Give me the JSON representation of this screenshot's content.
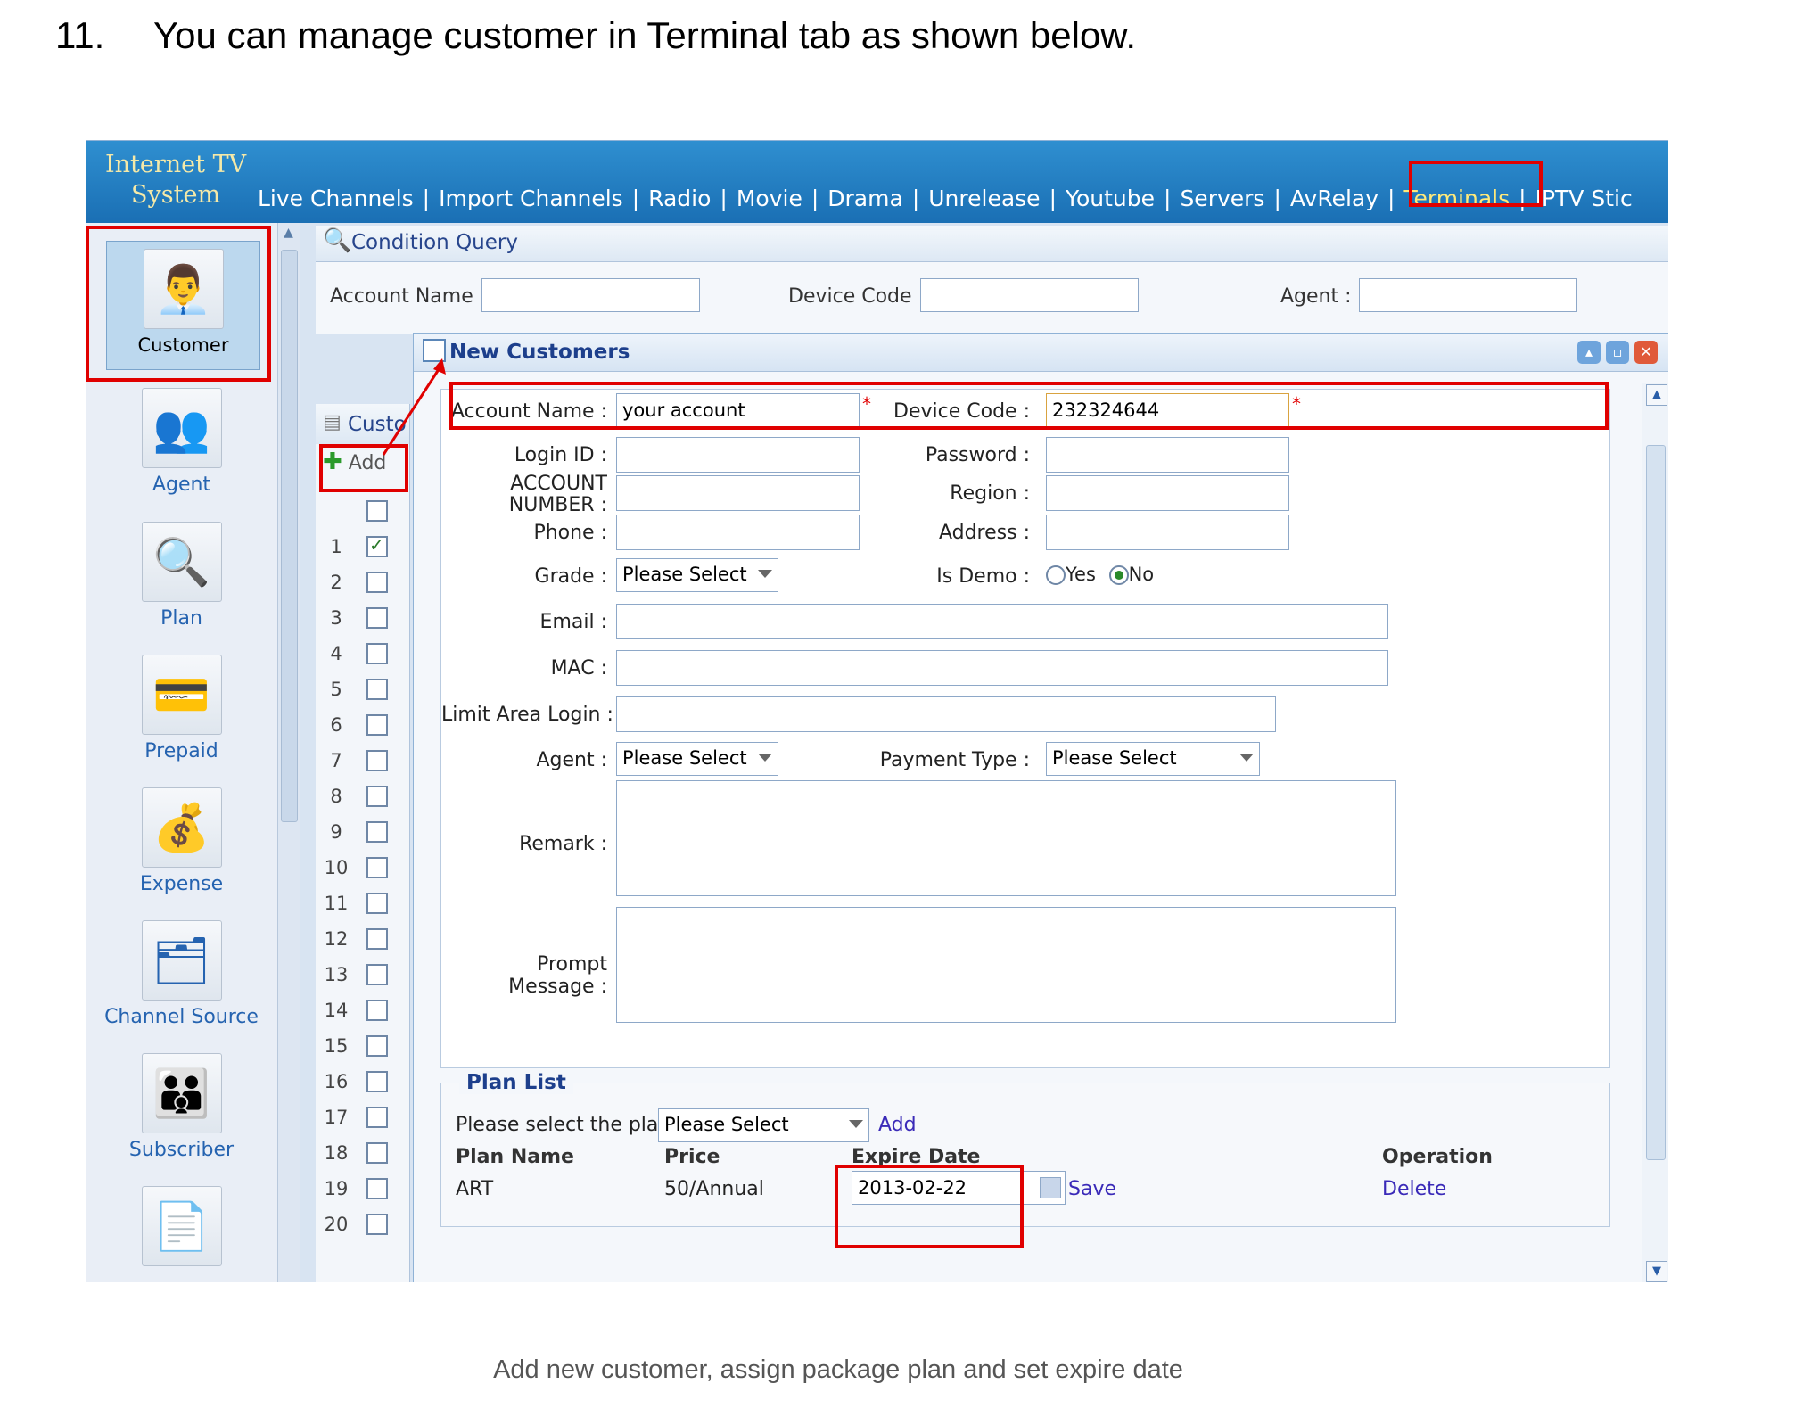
{
  "doc": {
    "step_number": "11.",
    "step_text": "You can manage customer in Terminal tab as shown below.",
    "caption": "Add new customer, assign package plan and set expire date"
  },
  "app": {
    "logo_line1": "Internet TV",
    "logo_line2": "System"
  },
  "nav": {
    "items": [
      "Live Channels",
      "Import Channels",
      "Radio",
      "Movie",
      "Drama",
      "Unrelease",
      "Youtube",
      "Servers",
      "AvRelay",
      "Terminals",
      "IPTV Stic"
    ],
    "active": "Terminals"
  },
  "sidebar": {
    "items": [
      {
        "label": "Customer",
        "icon": "customer-icon"
      },
      {
        "label": "Agent",
        "icon": "agent-icon"
      },
      {
        "label": "Plan",
        "icon": "plan-icon"
      },
      {
        "label": "Prepaid",
        "icon": "prepaid-card-icon"
      },
      {
        "label": "Expense",
        "icon": "expense-icon"
      },
      {
        "label": "Channel Source",
        "icon": "channel-source-icon"
      },
      {
        "label": "Subscriber",
        "icon": "subscriber-icon"
      },
      {
        "label": "",
        "icon": "document-icon"
      }
    ]
  },
  "condition_query": {
    "title": "Condition Query",
    "account_name_label": "Account Name :",
    "device_code_label": "Device Code :",
    "agent_label": "Agent :"
  },
  "grid": {
    "title": "Custo",
    "add_label": "Add",
    "rows": [
      "1",
      "2",
      "3",
      "4",
      "5",
      "6",
      "7",
      "8",
      "9",
      "10",
      "11",
      "12",
      "13",
      "14",
      "15",
      "16",
      "17",
      "18",
      "19",
      "20"
    ],
    "checked_row": "1"
  },
  "dialog": {
    "title": "New Customers",
    "account_name_label": "Account Name :",
    "account_name_value": "your account",
    "device_code_label": "Device Code :",
    "device_code_value": "232324644",
    "login_id_label": "Login ID :",
    "password_label": "Password :",
    "account_number_label_1": "ACCOUNT",
    "account_number_label_2": "NUMBER :",
    "region_label": "Region :",
    "phone_label": "Phone :",
    "address_label": "Address :",
    "grade_label": "Grade :",
    "grade_value": "Please Select",
    "is_demo_label": "Is Demo :",
    "is_demo_yes": "Yes",
    "is_demo_no": "No",
    "email_label": "Email :",
    "mac_label": "MAC :",
    "limit_area_label": "Limit Area Login :",
    "agent_label": "Agent :",
    "agent_value": "Please Select",
    "payment_type_label": "Payment Type :",
    "payment_type_value": "Please Select",
    "remark_label": "Remark :",
    "prompt_label_1": "Prompt",
    "prompt_label_2": "Message :",
    "required_mark": "*"
  },
  "plan_list": {
    "legend": "Plan List",
    "select_label": "Please select the plan",
    "select_value": "Please Select",
    "add_link": "Add",
    "headers": {
      "name": "Plan Name",
      "price": "Price",
      "expire": "Expire Date",
      "operation": "Operation"
    },
    "rows": [
      {
        "name": "ART",
        "price": "50/Annual",
        "expire": "2013-02-22",
        "save": "Save",
        "delete": "Delete"
      }
    ]
  }
}
